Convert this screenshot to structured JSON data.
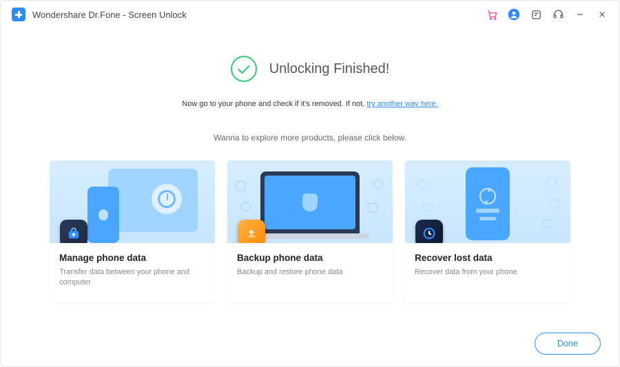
{
  "title": "Wondershare Dr.Fone - Screen Unlock",
  "result": {
    "heading": "Unlocking Finished!",
    "sub_prefix": "Now go to your phone and check if it's removed. If not, ",
    "sub_link": "try another way here.",
    "explore": "Wanna to explore more products,  please click below."
  },
  "cards": [
    {
      "title": "Manage phone data",
      "desc": "Transfer data between your phone and computer"
    },
    {
      "title": "Backup phone data",
      "desc": "Backup and restore phone data"
    },
    {
      "title": "Recover lost data",
      "desc": "Recover data from your phone"
    }
  ],
  "footer": {
    "done": "Done"
  }
}
